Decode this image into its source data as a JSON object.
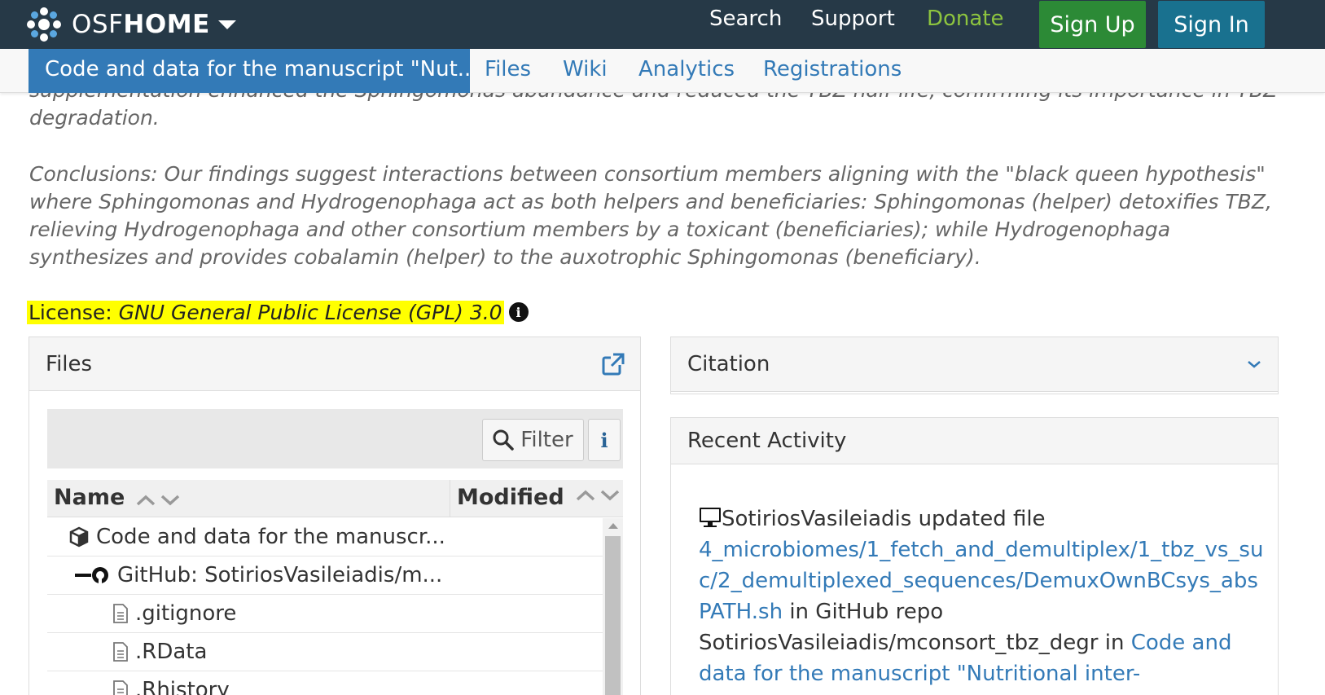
{
  "navbar": {
    "brand_osf": "OSF",
    "brand_home": "HOME",
    "links": [
      "Search",
      "Support",
      "Donate"
    ],
    "sign_up": "Sign Up",
    "sign_in": "Sign In",
    "donate_color": "#8dc43f",
    "bg_color": "#263947"
  },
  "project_nav": {
    "project_title": "Code and data for the manuscript \"Nut...",
    "tabs": [
      "Files",
      "Wiki",
      "Analytics",
      "Registrations"
    ]
  },
  "description": {
    "partial_line": "supplementation enhanced the Sphingomonas abundance and reduced the TBZ half-life, confirming its importance in TBZ",
    "partial_line_2": "degradation.",
    "conclusions": [
      "Conclusions: Our findings suggest interactions between consortium members aligning with the \"black queen hypothesis\"",
      "where Sphingomonas and Hydrogenophaga act as both helpers and beneficiaries: Sphingomonas (helper) detoxifies TBZ,",
      "relieving Hydrogenophaga and other consortium members by a toxicant (beneficiaries); while Hydrogenophaga",
      "synthesizes and provides cobalamin (helper) to the auxotrophic Sphingomonas (beneficiary)."
    ]
  },
  "license": {
    "label": "License:",
    "value": "GNU General Public License (GPL) 3.0",
    "highlight_color": "#ffff00"
  },
  "files_panel": {
    "title": "Files",
    "filter_label": "Filter",
    "columns": [
      "Name",
      "Modified"
    ],
    "rows": [
      {
        "name": "Code and data for the manuscr...",
        "icon": "cube-icon",
        "indent": 0
      },
      {
        "name": "GitHub: SotiriosVasileiadis/m...",
        "icon": "github-icon",
        "indent": 1
      },
      {
        "name": ".gitignore",
        "icon": "file-icon",
        "indent": 2
      },
      {
        "name": ".RData",
        "icon": "file-icon",
        "indent": 2
      },
      {
        "name": ".Rhistory",
        "icon": "file-icon",
        "indent": 2
      }
    ]
  },
  "citation_panel": {
    "title": "Citation"
  },
  "activity_panel": {
    "title": "Recent Activity",
    "entry": {
      "actor_text": "SotiriosVasileiadis updated file",
      "file_path": "4_microbiomes/1_fetch_and_demultiplex/1_tbz_vs_su c/2_demultiplexed_sequences/DemuxOwnBCsys_abs PATH.sh",
      "file_path_lines": [
        "4_microbiomes/1_fetch_and_demultiplex/1_tbz_vs_su",
        "c/2_demultiplexed_sequences/DemuxOwnBCsys_abs",
        "PATH.sh"
      ],
      "in_repo_text": " in GitHub repo",
      "repo_text": "SotiriosVasileiadis/mconsort_tbz_degr in ",
      "project_link_1": "Code and",
      "project_link_2": "data for the manuscript \"Nutritional inter-"
    }
  }
}
